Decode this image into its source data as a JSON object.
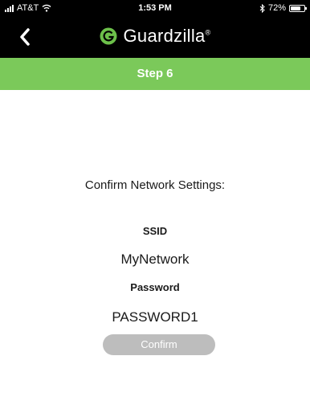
{
  "status_bar": {
    "carrier": "AT&T",
    "time": "1:53 PM",
    "battery": "72%",
    "battery_level": 0.72,
    "icons": [
      "signal-icon",
      "wifi-icon",
      "bluetooth-icon",
      "battery-icon"
    ]
  },
  "nav": {
    "back_icon": "chevron-left-icon",
    "brand_name": "Guardzilla",
    "brand_mark": "®"
  },
  "step": {
    "label": "Step 6"
  },
  "confirm": {
    "heading": "Confirm Network Settings:",
    "ssid_label": "SSID",
    "ssid_value": "MyNetwork",
    "password_label": "Password",
    "password_value": "PASSWORD1",
    "button_label": "Confirm"
  },
  "colors": {
    "header_bg": "#000000",
    "step_banner": "#7bc95a",
    "button_disabled": "#bdbdbd",
    "brand_green": "#6cc04a"
  }
}
